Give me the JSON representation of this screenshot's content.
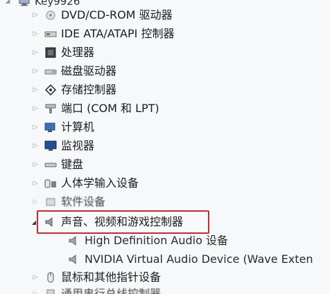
{
  "root": {
    "label": "Key9926"
  },
  "items": [
    {
      "label": "DVD/CD-ROM 驱动器",
      "icon": "optical-drive-icon"
    },
    {
      "label": "IDE ATA/ATAPI 控制器",
      "icon": "ide-controller-icon"
    },
    {
      "label": "处理器",
      "icon": "processor-icon"
    },
    {
      "label": "磁盘驱动器",
      "icon": "disk-drive-icon"
    },
    {
      "label": "存储控制器",
      "icon": "storage-controller-icon"
    },
    {
      "label": "端口 (COM 和 LPT)",
      "icon": "port-icon"
    },
    {
      "label": "计算机",
      "icon": "computer-icon"
    },
    {
      "label": "监视器",
      "icon": "monitor-icon"
    },
    {
      "label": "键盘",
      "icon": "keyboard-icon"
    },
    {
      "label": "人体学输入设备",
      "icon": "hid-icon"
    },
    {
      "label": "软件设备",
      "icon": "software-device-icon"
    },
    {
      "label": "声音、视频和游戏控制器",
      "icon": "audio-icon"
    },
    {
      "label": "High Definition Audio 设备",
      "icon": "speaker-icon"
    },
    {
      "label": "NVIDIA Virtual Audio Device (Wave Exten",
      "icon": "speaker-icon"
    },
    {
      "label": "鼠标和其他指针设备",
      "icon": "mouse-icon"
    },
    {
      "label": "通用串行总线控制器",
      "icon": "usb-icon"
    }
  ],
  "highlight": {
    "color": "#d4262f"
  }
}
